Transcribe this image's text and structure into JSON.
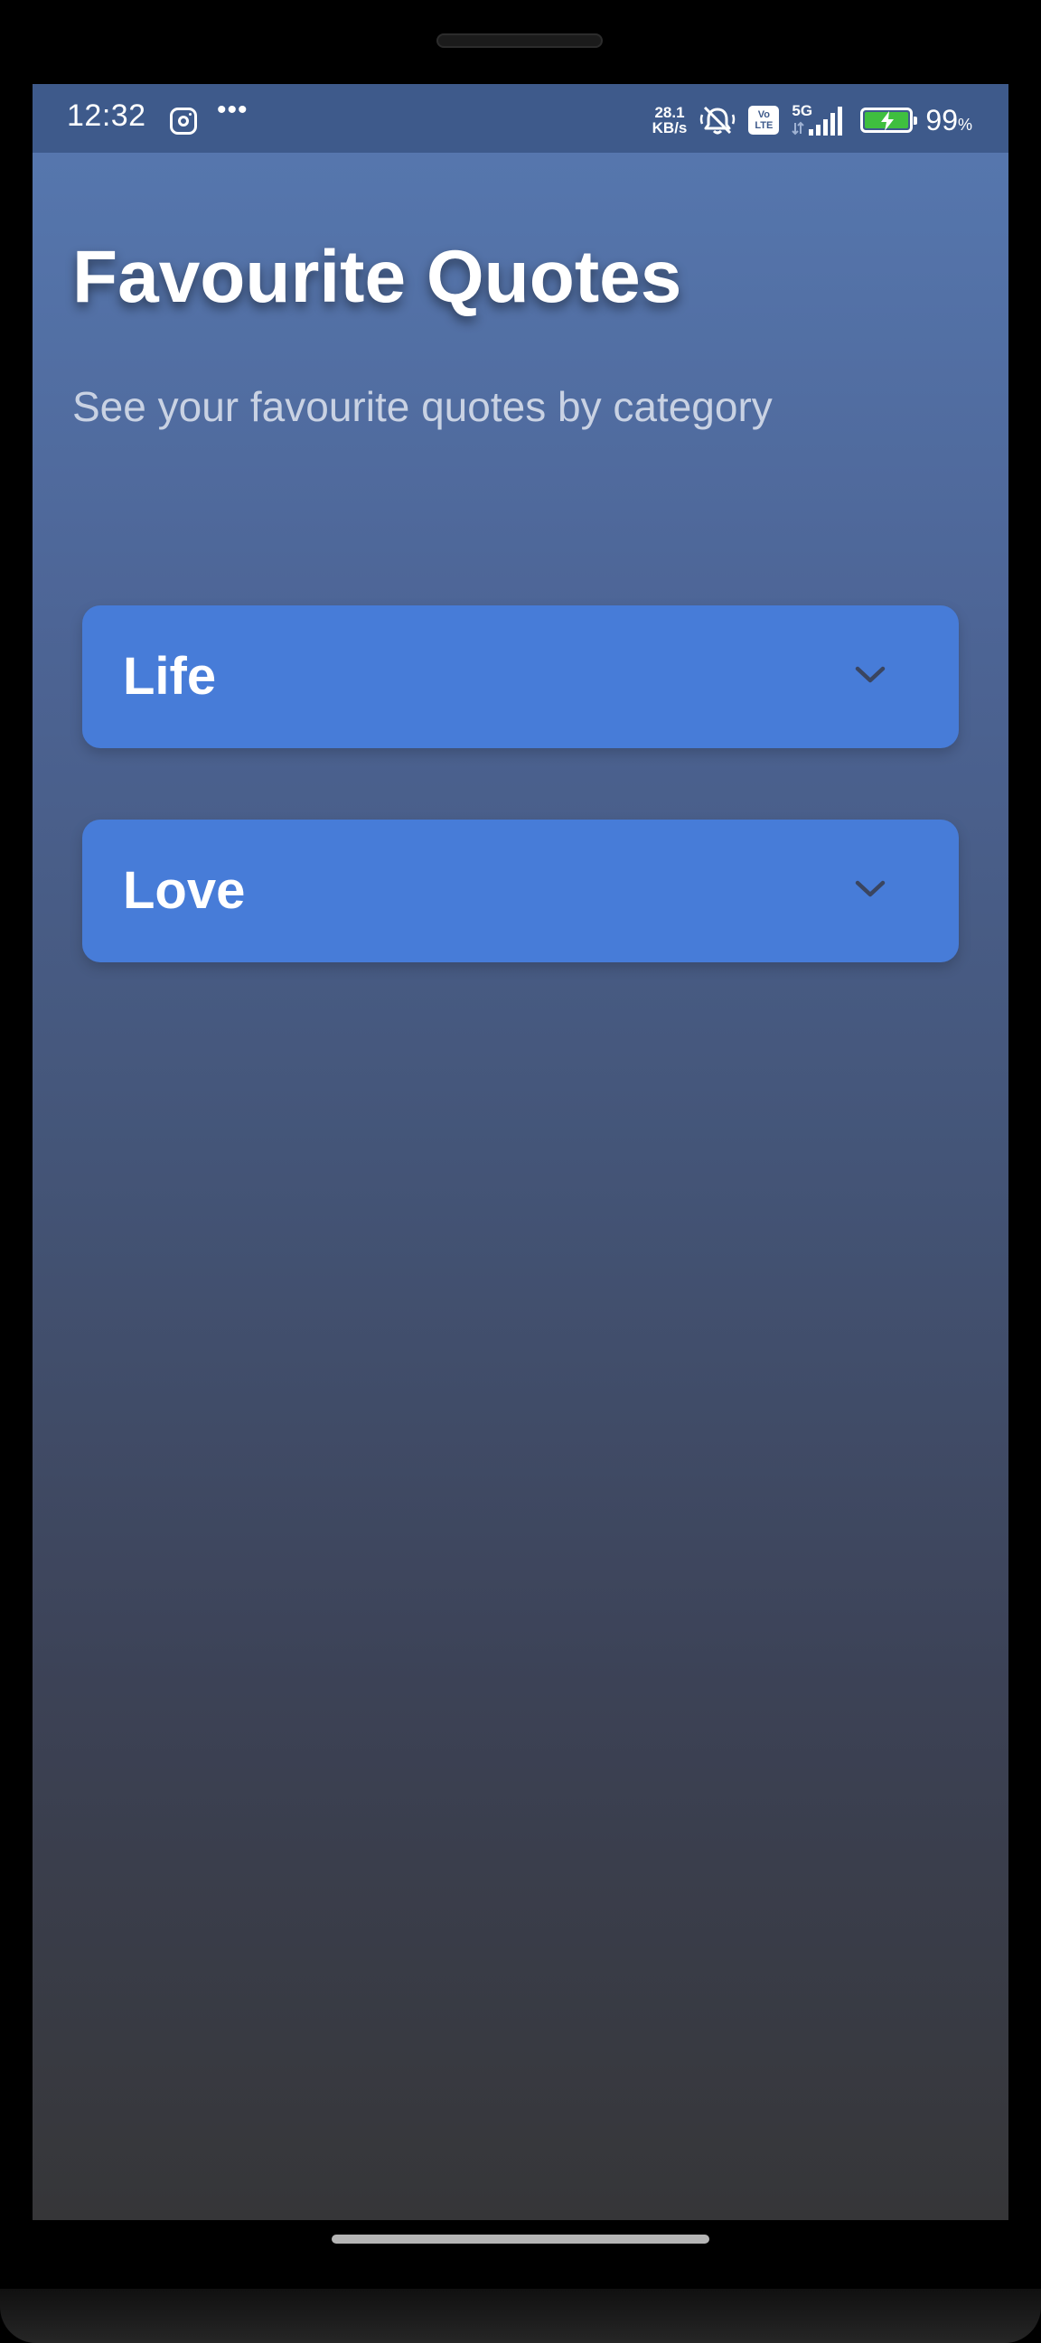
{
  "status_bar": {
    "time": "12:32",
    "dots": "•••",
    "net_speed_value": "28.1",
    "net_speed_unit": "KB/s",
    "volte_top": "Vo",
    "volte_bottom": "LTE",
    "network": "5G",
    "battery_percent": "99",
    "battery_unit": "%",
    "battery_level": 0.99,
    "battery_color": "#3fbf3f",
    "icons": [
      "instagram-icon",
      "more-dots-icon",
      "bell-off-icon",
      "volte-icon",
      "signal-icon",
      "battery-charging-icon"
    ]
  },
  "header": {
    "title": "Favourite Quotes",
    "subtitle": "See your favourite quotes by category"
  },
  "categories": [
    {
      "label": "Life",
      "icon": "chevron-down-icon"
    },
    {
      "label": "Love",
      "icon": "chevron-down-icon"
    }
  ],
  "colors": {
    "accent": "#477cd8",
    "gradient_top": "#5779b1",
    "gradient_bottom": "#363638",
    "chevron": "#3a4560"
  }
}
